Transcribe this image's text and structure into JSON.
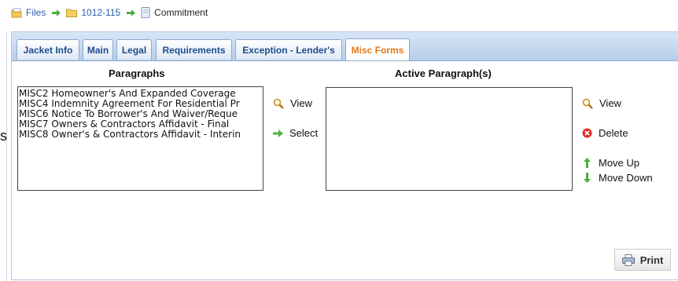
{
  "breadcrumb": {
    "items": [
      "Files",
      "1012-115",
      "Commitment"
    ]
  },
  "stray_text": "s",
  "tabs": [
    {
      "label": "Jacket Info",
      "active": false
    },
    {
      "label": "Main",
      "active": false
    },
    {
      "label": "Legal",
      "active": false
    },
    {
      "label": "Requirements",
      "active": false
    },
    {
      "label": "Exception - Lender's",
      "active": false
    },
    {
      "label": "Misc Forms",
      "active": true
    }
  ],
  "paragraphs": {
    "heading": "Paragraphs",
    "items": [
      "MISC2 Homeowner's And Expanded Coverage",
      "MISC4 Indemnity Agreement For Residential Pr",
      "MISC6 Notice To Borrower's And Waiver/Reque",
      "MISC7 Owners & Contractors Affidavit - Final",
      "MISC8 Owner's & Contractors Affidavit - Interin"
    ]
  },
  "middle_actions": {
    "view": "View",
    "select": "Select"
  },
  "active": {
    "heading": "Active Paragraph(s)",
    "items": []
  },
  "right_actions": {
    "view": "View",
    "delete": "Delete",
    "move_up": "Move Up",
    "move_down": "Move Down"
  },
  "print_label": "Print",
  "colors": {
    "active_tab": "#e07a1a",
    "tab_text": "#1e4c8c",
    "link": "#2a5db0"
  }
}
